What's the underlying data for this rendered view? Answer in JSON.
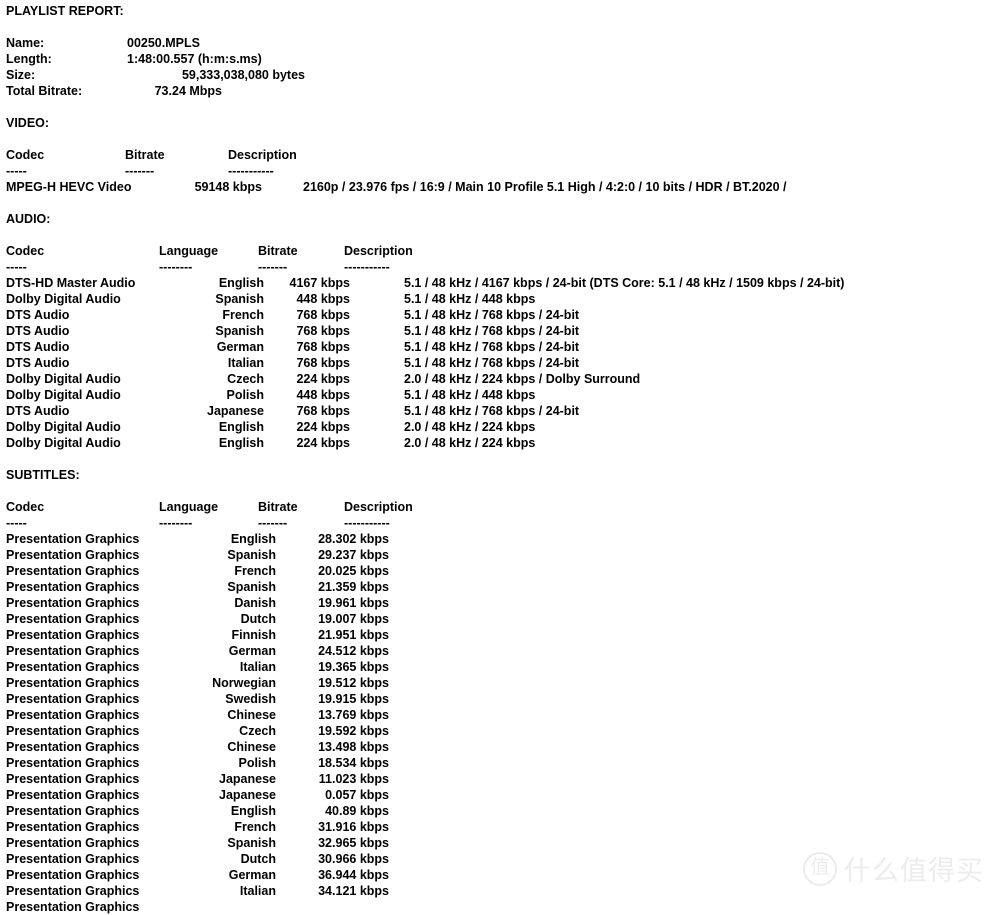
{
  "report": {
    "title": "PLAYLIST REPORT:",
    "summary": {
      "labels": [
        "Name:",
        "Length:",
        "Size:",
        "Total Bitrate:"
      ],
      "name": "00250.MPLS",
      "length": "1:48:00.557 (h:m:s.ms)",
      "size": "59,333,038,080 bytes",
      "total_bitrate": "73.24 Mbps"
    },
    "video": {
      "heading": "VIDEO:",
      "columns": [
        "Codec",
        "Bitrate",
        "Description"
      ],
      "dashes": [
        "-----",
        "-------",
        "-----------"
      ],
      "rows": [
        {
          "codec": "MPEG-H HEVC Video",
          "bitrate": "59148 kbps",
          "description": "2160p / 23.976 fps / 16:9 / Main 10 Profile 5.1 High / 4:2:0 / 10 bits / HDR / BT.2020 /"
        }
      ]
    },
    "audio": {
      "heading": "AUDIO:",
      "columns": [
        "Codec",
        "Language",
        "Bitrate",
        "Description"
      ],
      "dashes": [
        "-----",
        "--------",
        "-------",
        "-----------"
      ],
      "rows": [
        {
          "codec": "DTS-HD Master Audio",
          "language": "English",
          "bitrate": "4167 kbps",
          "description": "5.1 / 48 kHz / 4167 kbps / 24-bit (DTS Core: 5.1 / 48 kHz / 1509 kbps / 24-bit)"
        },
        {
          "codec": "Dolby Digital Audio",
          "language": "Spanish",
          "bitrate": "448 kbps",
          "description": "5.1 / 48 kHz / 448 kbps"
        },
        {
          "codec": "DTS Audio",
          "language": "French",
          "bitrate": "768 kbps",
          "description": "5.1 / 48 kHz / 768 kbps / 24-bit"
        },
        {
          "codec": "DTS Audio",
          "language": "Spanish",
          "bitrate": "768 kbps",
          "description": "5.1 / 48 kHz / 768 kbps / 24-bit"
        },
        {
          "codec": "DTS Audio",
          "language": "German",
          "bitrate": "768 kbps",
          "description": "5.1 / 48 kHz / 768 kbps / 24-bit"
        },
        {
          "codec": "DTS Audio",
          "language": "Italian",
          "bitrate": "768 kbps",
          "description": "5.1 / 48 kHz / 768 kbps / 24-bit"
        },
        {
          "codec": "Dolby Digital Audio",
          "language": "Czech",
          "bitrate": "224 kbps",
          "description": "2.0 / 48 kHz / 224 kbps / Dolby Surround"
        },
        {
          "codec": "Dolby Digital Audio",
          "language": "Polish",
          "bitrate": "448 kbps",
          "description": "5.1 / 48 kHz / 448 kbps"
        },
        {
          "codec": "DTS Audio",
          "language": "Japanese",
          "bitrate": "768 kbps",
          "description": "5.1 / 48 kHz / 768 kbps / 24-bit"
        },
        {
          "codec": "Dolby Digital Audio",
          "language": "English",
          "bitrate": "224 kbps",
          "description": "2.0 / 48 kHz / 224 kbps"
        },
        {
          "codec": "Dolby Digital Audio",
          "language": "English",
          "bitrate": "224 kbps",
          "description": "2.0 / 48 kHz / 224 kbps"
        }
      ]
    },
    "subtitles": {
      "heading": "SUBTITLES:",
      "columns": [
        "Codec",
        "Language",
        "Bitrate",
        "Description"
      ],
      "dashes": [
        "-----",
        "--------",
        "-------",
        "-----------"
      ],
      "rows": [
        {
          "codec": "Presentation Graphics",
          "language": "English",
          "bitrate": "28.302 kbps",
          "description": ""
        },
        {
          "codec": "Presentation Graphics",
          "language": "Spanish",
          "bitrate": "29.237 kbps",
          "description": ""
        },
        {
          "codec": "Presentation Graphics",
          "language": "French",
          "bitrate": "20.025 kbps",
          "description": ""
        },
        {
          "codec": "Presentation Graphics",
          "language": "Spanish",
          "bitrate": "21.359 kbps",
          "description": ""
        },
        {
          "codec": "Presentation Graphics",
          "language": "Danish",
          "bitrate": "19.961 kbps",
          "description": ""
        },
        {
          "codec": "Presentation Graphics",
          "language": "Dutch",
          "bitrate": "19.007 kbps",
          "description": ""
        },
        {
          "codec": "Presentation Graphics",
          "language": "Finnish",
          "bitrate": "21.951 kbps",
          "description": ""
        },
        {
          "codec": "Presentation Graphics",
          "language": "German",
          "bitrate": "24.512 kbps",
          "description": ""
        },
        {
          "codec": "Presentation Graphics",
          "language": "Italian",
          "bitrate": "19.365 kbps",
          "description": ""
        },
        {
          "codec": "Presentation Graphics",
          "language": "Norwegian",
          "bitrate": "19.512 kbps",
          "description": ""
        },
        {
          "codec": "Presentation Graphics",
          "language": "Swedish",
          "bitrate": "19.915 kbps",
          "description": ""
        },
        {
          "codec": "Presentation Graphics",
          "language": "Chinese",
          "bitrate": "13.769 kbps",
          "description": ""
        },
        {
          "codec": "Presentation Graphics",
          "language": "Czech",
          "bitrate": "19.592 kbps",
          "description": ""
        },
        {
          "codec": "Presentation Graphics",
          "language": "Chinese",
          "bitrate": "13.498 kbps",
          "description": ""
        },
        {
          "codec": "Presentation Graphics",
          "language": "Polish",
          "bitrate": "18.534 kbps",
          "description": ""
        },
        {
          "codec": "Presentation Graphics",
          "language": "Japanese",
          "bitrate": "11.023 kbps",
          "description": ""
        },
        {
          "codec": "Presentation Graphics",
          "language": "Japanese",
          "bitrate": "0.057 kbps",
          "description": ""
        },
        {
          "codec": "Presentation Graphics",
          "language": "English",
          "bitrate": "40.89 kbps",
          "description": ""
        },
        {
          "codec": "Presentation Graphics",
          "language": "French",
          "bitrate": "31.916 kbps",
          "description": ""
        },
        {
          "codec": "Presentation Graphics",
          "language": "Spanish",
          "bitrate": "32.965 kbps",
          "description": ""
        },
        {
          "codec": "Presentation Graphics",
          "language": "Dutch",
          "bitrate": "30.966 kbps",
          "description": ""
        },
        {
          "codec": "Presentation Graphics",
          "language": "German",
          "bitrate": "36.944 kbps",
          "description": ""
        },
        {
          "codec": "Presentation Graphics",
          "language": "Italian",
          "bitrate": "34.121 kbps",
          "description": ""
        },
        {
          "codec": "Presentation Graphics",
          "language": "",
          "bitrate": "",
          "description": ""
        }
      ]
    }
  },
  "watermark": {
    "badge": "值",
    "text": "什么值得买",
    "color": "#ececed"
  }
}
